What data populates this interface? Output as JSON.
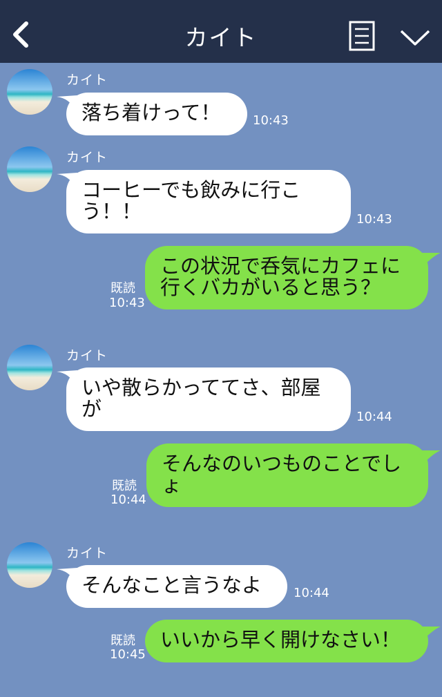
{
  "header": {
    "title": "カイト"
  },
  "contact_name": "カイト",
  "read_label": "既読",
  "messages": [
    {
      "text": "落ち着けって！",
      "time": "10:43"
    },
    {
      "text": "コーヒーでも飲みに行こう！！",
      "time": "10:43"
    },
    {
      "text": "この状況で呑気にカフェに行くバカがいると思う？",
      "time": "10:43"
    },
    {
      "text": "いや散らかっててさ、部屋が",
      "time": "10:44"
    },
    {
      "text": "そんなのいつものことでしょ",
      "time": "10:44"
    },
    {
      "text": "そんなこと言うなよ",
      "time": "10:44"
    },
    {
      "text": "いいから早く開けなさい！",
      "time": "10:45"
    }
  ]
}
